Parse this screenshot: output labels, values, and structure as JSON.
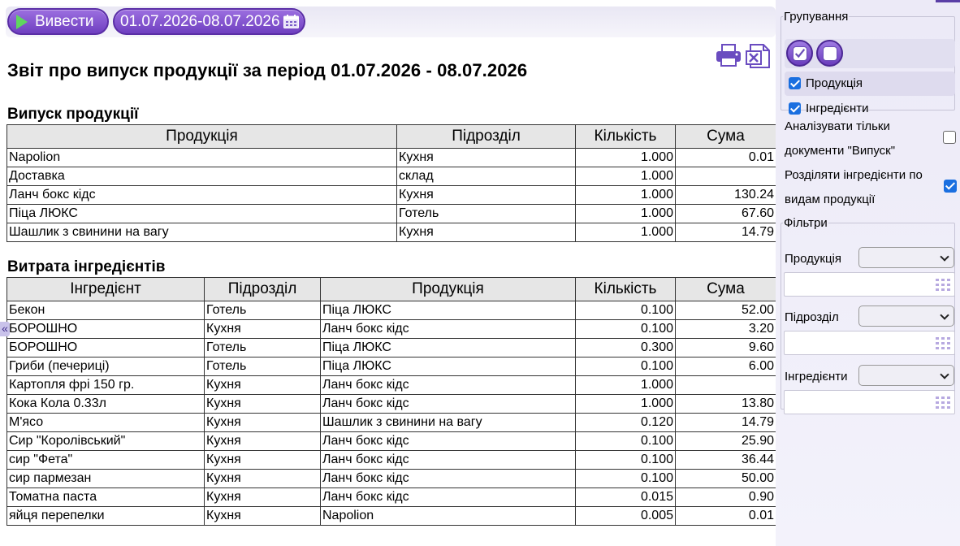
{
  "toolbar": {
    "run_label": "Вивести",
    "period_label": "01.07.2026-08.07.2026"
  },
  "report": {
    "title": "Звіт про випуск продукції за період 01.07.2026 - 08.07.2026",
    "output": {
      "title": "Випуск продукції",
      "headers": [
        "Продукція",
        "Підрозділ",
        "Кількість",
        "Сума"
      ],
      "rows": [
        [
          "Napolion",
          "Кухня",
          "1.000",
          "0.01"
        ],
        [
          "Доставка",
          "склад",
          "1.000",
          ""
        ],
        [
          "Ланч бокс кідс",
          "Кухня",
          "1.000",
          "130.24"
        ],
        [
          "Піца ЛЮКС",
          "Готель",
          "1.000",
          "67.60"
        ],
        [
          "Шашлик з свинини на вагу",
          "Кухня",
          "1.000",
          "14.79"
        ]
      ]
    },
    "ingredients": {
      "title": "Витрата інгредієнтів",
      "headers": [
        "Інгредієнт",
        "Підрозділ",
        "Продукція",
        "Кількість",
        "Сума"
      ],
      "rows": [
        [
          "Бекон",
          "Готель",
          "Піца ЛЮКС",
          "0.100",
          "52.00"
        ],
        [
          "БОРОШНО",
          "Кухня",
          "Ланч бокс кідс",
          "0.100",
          "3.20"
        ],
        [
          "БОРОШНО",
          "Готель",
          "Піца ЛЮКС",
          "0.300",
          "9.60"
        ],
        [
          "Гриби (печериці)",
          "Готель",
          "Піца ЛЮКС",
          "0.100",
          "6.00"
        ],
        [
          "Картопля фрі 150 гр.",
          "Кухня",
          "Ланч бокс кідс",
          "1.000",
          ""
        ],
        [
          "Кока Кола 0.33л",
          "Кухня",
          "Ланч бокс кідс",
          "1.000",
          "13.80"
        ],
        [
          "М'ясо",
          "Кухня",
          "Шашлик з свинини на вагу",
          "0.120",
          "14.79"
        ],
        [
          "Сир \"Королівський\"",
          "Кухня",
          "Ланч бокс кідс",
          "0.100",
          "25.90"
        ],
        [
          "сир \"Фета\"",
          "Кухня",
          "Ланч бокс кідс",
          "0.100",
          "36.44"
        ],
        [
          "сир пармезан",
          "Кухня",
          "Ланч бокс кідс",
          "0.100",
          "50.00"
        ],
        [
          "Томатна паста",
          "Кухня",
          "Ланч бокс кідс",
          "0.015",
          "0.90"
        ],
        [
          "яйця перепелки",
          "Кухня",
          "Napolion",
          "0.005",
          "0.01"
        ]
      ]
    }
  },
  "panel": {
    "grouping": {
      "legend": "Групування",
      "options": [
        {
          "label": "Продукція",
          "checked": true
        },
        {
          "label": "Інгредієнти",
          "checked": true
        }
      ]
    },
    "analyze_only_line1": "Аналізувати тільки",
    "analyze_only_line2": "документи \"Випуск\"",
    "analyze_only_checked": false,
    "split_line1": "Розділяти інгредієнти по",
    "split_line2": "видам продукції",
    "split_checked": true,
    "filters": {
      "legend": "Фільтри",
      "items": [
        {
          "label": "Продукція"
        },
        {
          "label": "Підрозділ"
        },
        {
          "label": "Інгредієнти"
        }
      ]
    }
  },
  "collapse_glyph": "«",
  "icons": [
    "play-icon",
    "calendar-icon",
    "print-icon",
    "excel-icon",
    "check-all-icon",
    "uncheck-all-icon",
    "chevron-down-icon",
    "grid-icon"
  ],
  "colors": {
    "accent_purple": "#7b4bd0",
    "checkbox_blue": "#1a6fe0",
    "panel_bg": "#eceaf7",
    "header_bg": "#e6e6e6"
  }
}
